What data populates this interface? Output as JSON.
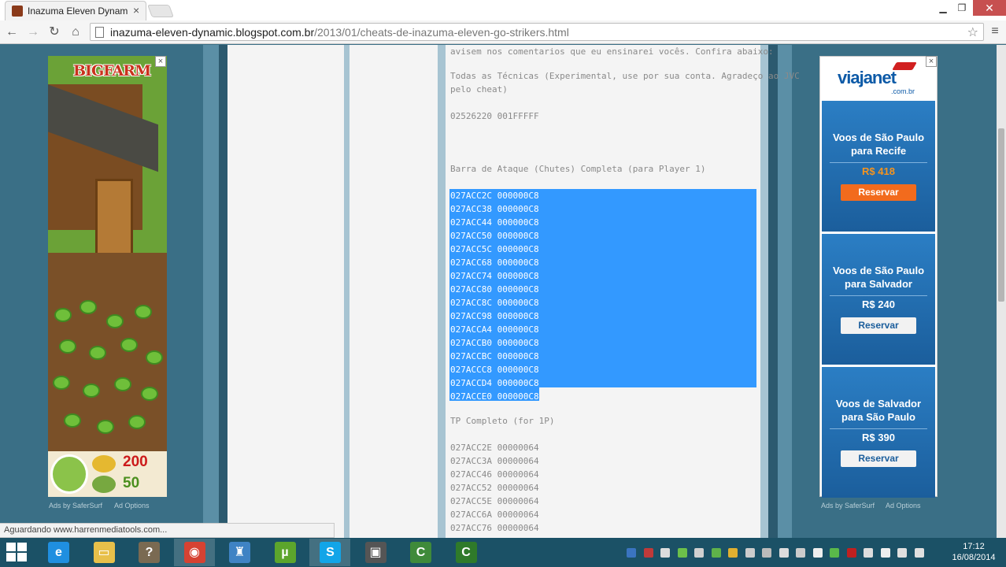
{
  "browser": {
    "tab_title": "Inazuma Eleven Dynamic",
    "tab_close": "×",
    "url_host": "inazuma-eleven-dynamic.blogspot.com.br",
    "url_path": "/2013/01/cheats-de-inazuma-eleven-go-strikers.html",
    "status_text": "Aguardando www.harrenmediatools.com..."
  },
  "left_ad": {
    "brand": "BIGFARM",
    "coins": "200",
    "seeds": "50",
    "close": "×",
    "ads_by": "Ads by SaferSurf",
    "ad_options": "Ad Options"
  },
  "post": {
    "intro_line": "avisem nos comentarios que eu ensinarei vocês. Confira abaixo:",
    "all_techniques_1": "Todas as Técnicas (Experimental, use por sua conta. Agradeço ao JVC",
    "all_techniques_2": "pelo cheat)",
    "all_techniques_code": "02526220 001FFFFF",
    "attack_bar_heading": "Barra de Ataque (Chutes) Completa (para Player 1)",
    "attack_bar_codes": [
      "027ACC2C 000000C8",
      "027ACC38 000000C8",
      "027ACC44 000000C8",
      "027ACC50 000000C8",
      "027ACC5C 000000C8",
      "027ACC68 000000C8",
      "027ACC74 000000C8",
      "027ACC80 000000C8",
      "027ACC8C 000000C8",
      "027ACC98 000000C8",
      "027ACCA4 000000C8",
      "027ACCB0 000000C8",
      "027ACCBC 000000C8",
      "027ACCC8 000000C8",
      "027ACCD4 000000C8",
      "027ACCE0 000000C8"
    ],
    "tp_heading": "TP Completo (for 1P)",
    "tp_codes": [
      "027ACC2E 00000064",
      "027ACC3A 00000064",
      "027ACC46 00000064",
      "027ACC52 00000064",
      "027ACC5E 00000064",
      "027ACC6A 00000064",
      "027ACC76 00000064"
    ]
  },
  "right_ad": {
    "brand": "viajanet",
    "brand_sub": ".com.br",
    "close": "×",
    "ads_by": "Ads by SaferSurf",
    "ad_options": "Ad Options",
    "offers": [
      {
        "title_1": "Voos de São Paulo",
        "title_2": "para Recife",
        "price": "R$ 418",
        "button": "Reservar",
        "price_color": "#f7941d",
        "button_bg": "#f26b1d",
        "button_color": "#ffffff"
      },
      {
        "title_1": "Voos de São Paulo",
        "title_2": "para Salvador",
        "price": "R$ 240",
        "button": "Reservar",
        "price_color": "#ffffff",
        "button_bg": "#f2f2f2",
        "button_color": "#1b5e9c"
      },
      {
        "title_1": "Voos de Salvador",
        "title_2": "para São Paulo",
        "price": "R$ 390",
        "button": "Reservar",
        "price_color": "#ffffff",
        "button_bg": "#f2f2f2",
        "button_color": "#1b5e9c"
      }
    ]
  },
  "taskbar": {
    "time": "17:12",
    "date": "16/08/2014",
    "apps": [
      {
        "name": "internet-explorer-icon",
        "glyph": "e",
        "color": "#1f8fe0",
        "active": false
      },
      {
        "name": "file-explorer-icon",
        "glyph": "▭",
        "color": "#e8c04a",
        "active": false
      },
      {
        "name": "help-icon",
        "glyph": "?",
        "color": "#7a6a52",
        "active": false
      },
      {
        "name": "chrome-icon",
        "glyph": "◉",
        "color": "#d64232",
        "active": true
      },
      {
        "name": "vpn-icon",
        "glyph": "♜",
        "color": "#3f83c4",
        "active": false
      },
      {
        "name": "utorrent-icon",
        "glyph": "µ",
        "color": "#5ca52c",
        "active": false
      },
      {
        "name": "skype-icon",
        "glyph": "S",
        "color": "#12a5e8",
        "active": true
      },
      {
        "name": "monitor-icon",
        "glyph": "▣",
        "color": "#555555",
        "active": false
      },
      {
        "name": "camtasia-icon",
        "glyph": "C",
        "color": "#3f8a3a",
        "active": false
      },
      {
        "name": "camtasia-recorder-icon",
        "glyph": "C",
        "color": "#2f7a2a",
        "active": false
      }
    ]
  }
}
